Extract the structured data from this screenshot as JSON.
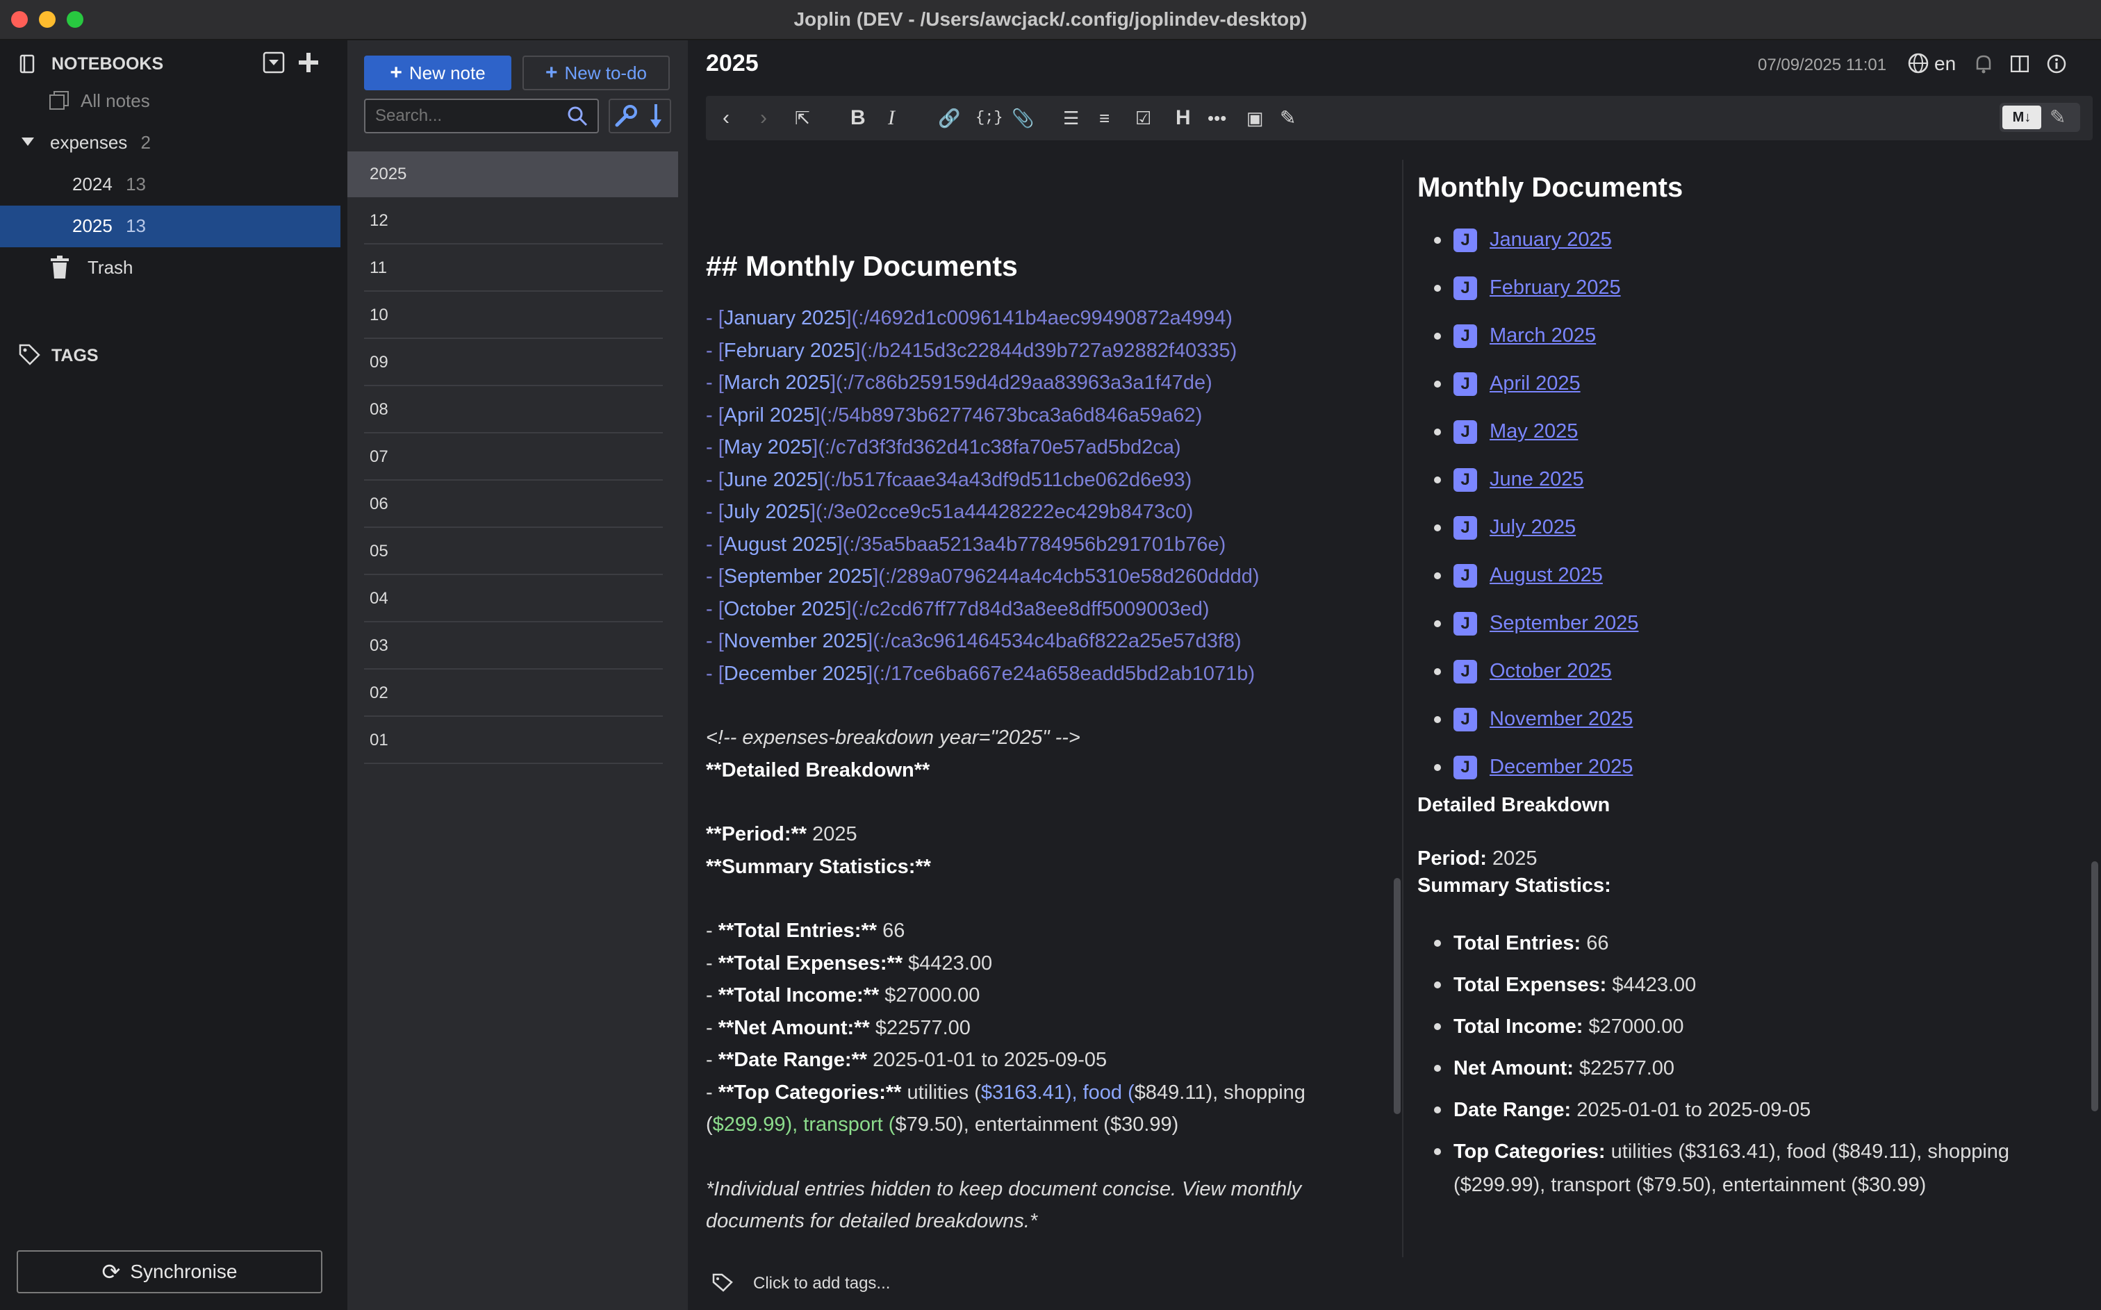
{
  "window": {
    "title": "Joplin (DEV - /Users/awcjack/.config/joplindev-desktop)"
  },
  "sidebar": {
    "notebooks_header": "NOTEBOOKS",
    "all_notes": "All notes",
    "notebooks": [
      {
        "name": "expenses",
        "count": "2"
      },
      {
        "name": "2024",
        "count": "13"
      },
      {
        "name": "2025",
        "count": "13"
      }
    ],
    "trash": "Trash",
    "tags_header": "TAGS",
    "sync_label": "Synchronise"
  },
  "notelist": {
    "new_note": "New note",
    "new_todo": "New to-do",
    "search_placeholder": "Search...",
    "items": [
      "2025",
      "12",
      "11",
      "10",
      "09",
      "08",
      "07",
      "06",
      "05",
      "04",
      "03",
      "02",
      "01"
    ]
  },
  "editor": {
    "title": "2025",
    "datetime": "07/09/2025 11:01",
    "language": "en",
    "md_badge": "M↓",
    "markdown": {
      "heading": "## Monthly Documents",
      "links": [
        {
          "text": "January 2025",
          "url": "(:/4692d1c0096141b4aec99490872a4994)"
        },
        {
          "text": "February 2025",
          "url": "(:/b2415d3c22844d39b727a92882f40335)"
        },
        {
          "text": "March 2025",
          "url": "(:/7c86b259159d4d29aa83963a3a1f47de)"
        },
        {
          "text": "April 2025",
          "url": "(:/54b8973b62774673bca3a6d846a59a62)"
        },
        {
          "text": "May 2025",
          "url": "(:/c7d3f3fd362d41c38fa70e57ad5bd2ca)"
        },
        {
          "text": "June 2025",
          "url": "(:/b517fcaae34a43df9d511cbe062d6e93)"
        },
        {
          "text": "July 2025",
          "url": "(:/3e02cce9c51a44428222ec429b8473c0)"
        },
        {
          "text": "August 2025",
          "url": "(:/35a5baa5213a4b7784956b291701b76e)"
        },
        {
          "text": "September 2025",
          "url": "(:/289a0796244a4c4cb5310e58d260dddd)"
        },
        {
          "text": "October 2025",
          "url": "(:/c2cd67ff77d84d3a8ee8dff5009003ed)"
        },
        {
          "text": "November 2025",
          "url": "(:/ca3c961464534c4ba6f822a25e57d3f8)"
        },
        {
          "text": "December 2025",
          "url": "(:/17ce6ba667e24a658eadd5bd2ab1071b)"
        }
      ],
      "comment": "<!-- expenses-breakdown year=\"2025\" -->",
      "detailed_breakdown": "**Detailed Breakdown**",
      "period_label": "**Period:**",
      "period_value": "2025",
      "summary_label": "**Summary Statistics:**",
      "stats": [
        {
          "label": "**Total Entries:**",
          "value": "66"
        },
        {
          "label": "**Total Expenses:**",
          "value": "$4423.00"
        },
        {
          "label": "**Total Income:**",
          "value": "$27000.00"
        },
        {
          "label": "**Net Amount:**",
          "value": "$22577.00"
        },
        {
          "label": "**Date Range:**",
          "value": "2025-01-01 to 2025-09-05"
        }
      ],
      "top_categories_label": "**Top Categories:**",
      "top_categories_line1": {
        "a": "utilities (",
        "b": "$3163.41), food (",
        "c": "$849.11), shopping"
      },
      "top_categories_line2": {
        "a": "(",
        "b": "$299.99), transport (",
        "c": "$79.50), entertainment ($30.99)"
      },
      "footer_note_1": "*Individual entries hidden to keep document concise. View monthly",
      "footer_note_2": "documents for detailed breakdowns.*"
    },
    "viewer": {
      "heading": "Monthly Documents",
      "links": [
        "January 2025",
        "February 2025",
        "March 2025",
        "April 2025",
        "May 2025",
        "June 2025",
        "July 2025",
        "August 2025",
        "September 2025",
        "October 2025",
        "November 2025",
        "December 2025"
      ],
      "detailed_breakdown": "Detailed Breakdown",
      "period_label": "Period:",
      "period_value": "2025",
      "summary_label": "Summary Statistics:",
      "stats": [
        {
          "label": "Total Entries:",
          "value": "66"
        },
        {
          "label": "Total Expenses:",
          "value": "$4423.00"
        },
        {
          "label": "Total Income:",
          "value": "$27000.00"
        },
        {
          "label": "Net Amount:",
          "value": "$22577.00"
        },
        {
          "label": "Date Range:",
          "value": "2025-01-01 to 2025-09-05"
        }
      ],
      "top_categories_label": "Top Categories:",
      "top_categories_value": "utilities ($3163.41), food ($849.11), shopping ($299.99), transport ($79.50), entertainment ($30.99)"
    },
    "tags_placeholder": "Click to add tags..."
  },
  "icons": [
    "notebook-icon",
    "all-notes-icon",
    "trash-icon",
    "tag-icon",
    "sync-icon",
    "plus-icon",
    "search-icon",
    "wrench-icon",
    "sort-arrow-icon",
    "globe-icon",
    "bell-icon",
    "layout-icon",
    "info-icon",
    "joplin-link-icon"
  ],
  "colors": {
    "accent": "#2e63c9",
    "selected": "#1f4a8a",
    "link": "#7b86ff"
  }
}
